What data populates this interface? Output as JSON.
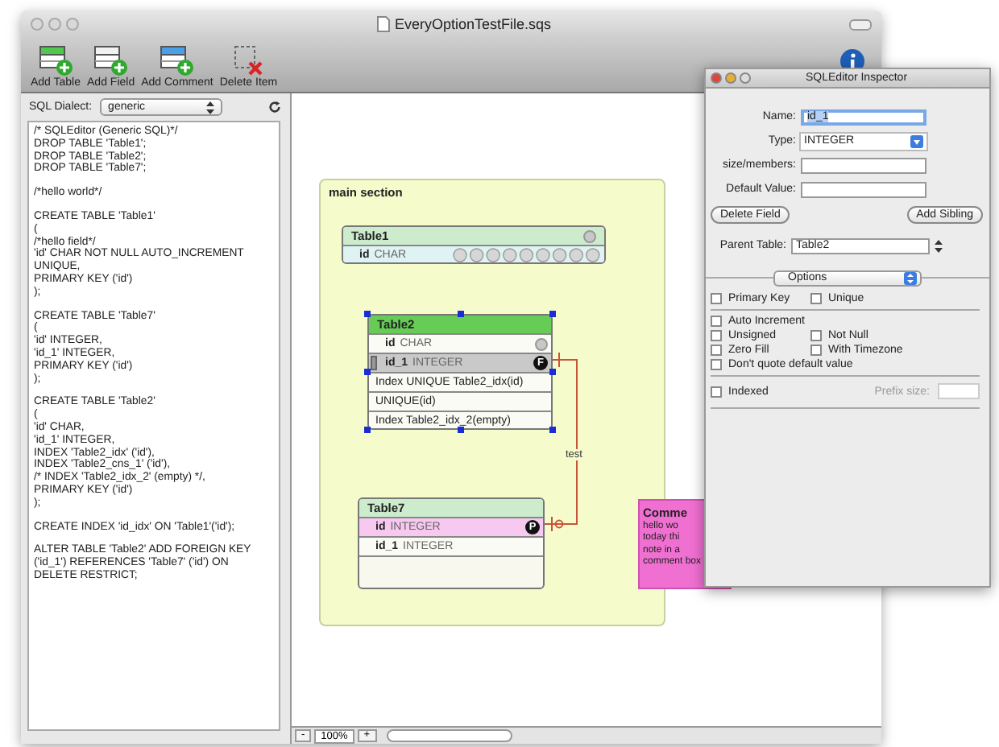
{
  "window": {
    "title": "EveryOptionTestFile.sqs"
  },
  "toolbar": [
    {
      "kind": "table",
      "label": "Add Table"
    },
    {
      "kind": "field",
      "label": "Add Field"
    },
    {
      "kind": "comment",
      "label": "Add Comment"
    },
    {
      "kind": "delete",
      "label": "Delete Item"
    }
  ],
  "sql_panel": {
    "dialect_label": "SQL Dialect:",
    "dialect_value": "generic",
    "script": [
      [
        "/* SQLEditor (Generic SQL)*/",
        "DROP TABLE 'Table1';",
        "DROP TABLE 'Table2';",
        "DROP TABLE 'Table7';"
      ],
      [
        "/*hello world*/"
      ],
      [
        "CREATE TABLE 'Table1'",
        "(",
        "/*hello field*/",
        "'id' CHAR NOT NULL AUTO_INCREMENT UNIQUE,",
        "PRIMARY KEY ('id')",
        ");"
      ],
      [
        "CREATE TABLE 'Table7'",
        "(",
        "'id' INTEGER,",
        "'id_1' INTEGER,",
        "PRIMARY KEY ('id')",
        ");"
      ],
      [
        "CREATE TABLE 'Table2'",
        "(",
        "'id' CHAR,",
        "'id_1' INTEGER,",
        "INDEX 'Table2_idx' ('id'),",
        "INDEX 'Table2_cns_1' ('id'),",
        "/* INDEX 'Table2_idx_2' (empty) */,",
        "PRIMARY KEY ('id')",
        ");"
      ],
      [
        "CREATE INDEX 'id_idx' ON 'Table1'('id');"
      ],
      [
        "ALTER TABLE 'Table2' ADD FOREIGN KEY ('id_1') REFERENCES 'Table7' ('id') ON DELETE RESTRICT;"
      ]
    ]
  },
  "canvas": {
    "section": {
      "title": "main section"
    },
    "tables": [
      {
        "name": "Table1",
        "selected": false,
        "help": true,
        "rows": [
          {
            "kind": "field",
            "name": "id",
            "type": "CHAR",
            "selected": false,
            "linked": false,
            "help": false,
            "options": true
          }
        ]
      },
      {
        "name": "Table2",
        "selected": true,
        "help": false,
        "rows": [
          {
            "kind": "field",
            "name": "id",
            "type": "CHAR",
            "selected": false,
            "linked": false,
            "help": true,
            "options": false
          },
          {
            "kind": "field",
            "name": "id_1",
            "type": "INTEGER",
            "selected": true,
            "linked": false,
            "help": false,
            "options": false,
            "badge": "F"
          },
          {
            "kind": "index",
            "text": "Index UNIQUE Table2_idx(id)",
            "selected": false,
            "linked": false,
            "help": false,
            "options": false
          },
          {
            "kind": "index",
            "text": "UNIQUE(id)",
            "selected": false,
            "linked": false,
            "help": false,
            "options": false
          },
          {
            "kind": "index",
            "text": "Index Table2_idx_2(empty)",
            "selected": false,
            "linked": false,
            "help": false,
            "options": false
          }
        ]
      },
      {
        "name": "Table7",
        "selected": false,
        "help": false,
        "rows": [
          {
            "kind": "field",
            "name": "id",
            "type": "INTEGER",
            "selected": false,
            "linked": true,
            "help": false,
            "options": false,
            "badge": "P"
          },
          {
            "kind": "field",
            "name": "id_1",
            "type": "INTEGER",
            "selected": false,
            "linked": false,
            "help": false,
            "options": false
          }
        ]
      }
    ],
    "relation": {
      "label": "test"
    },
    "comment": {
      "title": "Comme",
      "lines": [
        "hello wo",
        "today thi",
        "note in a",
        "comment box"
      ]
    }
  },
  "zoom": {
    "minus": "-",
    "value": "100%",
    "plus": "+"
  },
  "inspector": {
    "title": "SQLEditor Inspector",
    "fields": [
      {
        "kind": "text",
        "label": "Name:",
        "value": "id_1",
        "focused": true
      },
      {
        "kind": "select",
        "label": "Type:",
        "value": "INTEGER",
        "focused": false
      },
      {
        "kind": "text",
        "label": "size/members:",
        "focused": false
      },
      {
        "kind": "text",
        "label": "Default Value:",
        "focused": false
      }
    ],
    "buttons": [
      "Delete Field",
      "Add Sibling"
    ],
    "parent_label": "Parent Table:",
    "parent_value": "Table2",
    "options_value": "Options",
    "groups": [
      [
        [
          {
            "label": "Primary Key",
            "checked": false
          },
          {
            "label": "Unique",
            "checked": false
          }
        ]
      ],
      [
        [
          {
            "label": "Auto Increment",
            "checked": false
          }
        ],
        [
          {
            "label": "Unsigned",
            "checked": false
          },
          {
            "label": "Not Null",
            "checked": false
          }
        ],
        [
          {
            "label": "Zero Fill",
            "checked": false
          },
          {
            "label": "With Timezone",
            "checked": false
          }
        ],
        [
          {
            "label": "Don't quote default value",
            "checked": false
          }
        ]
      ]
    ],
    "indexed": {
      "label": "Indexed",
      "checked": false
    },
    "prefix_label": "Prefix size:"
  }
}
